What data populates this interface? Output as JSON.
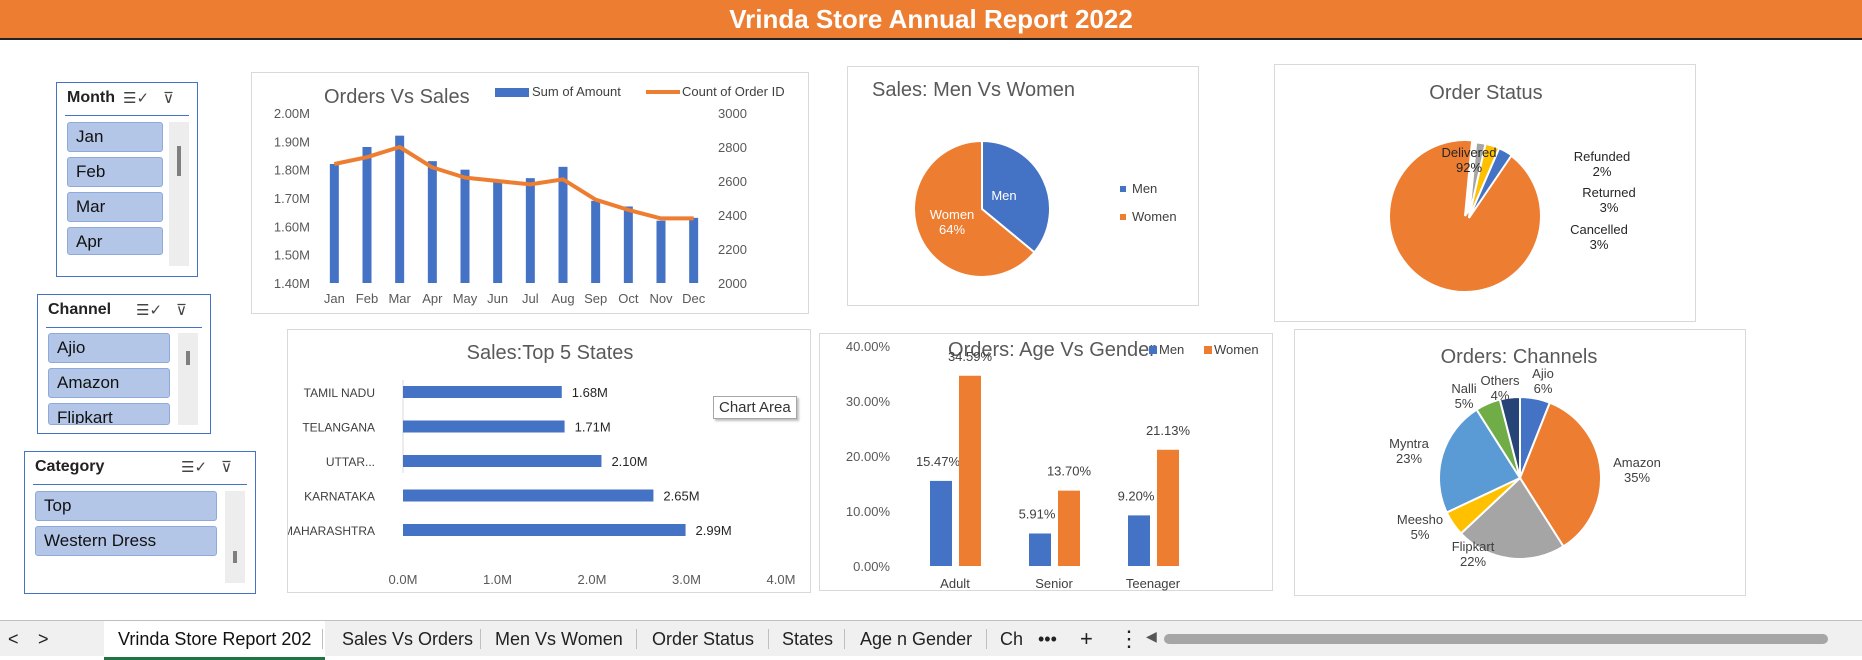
{
  "app": {
    "title": "Vrinda Store Annual Report 2022"
  },
  "slicers": {
    "month": {
      "title": "Month",
      "items": [
        "Jan",
        "Feb",
        "Mar",
        "Apr"
      ]
    },
    "channel": {
      "title": "Channel",
      "items": [
        "Ajio",
        "Amazon",
        "Flipkart"
      ]
    },
    "category": {
      "title": "Category",
      "items": [
        "Top",
        "Western Dress"
      ]
    }
  },
  "tooltip": "Chart Area",
  "tabs": {
    "prev": "<",
    "next": ">",
    "items": [
      "Vrinda Store Report 202",
      "Sales Vs Orders",
      "Men Vs Women",
      "Order Status",
      "States",
      "Age n Gender",
      "Ch"
    ],
    "more": "•••",
    "add": "+",
    "menu": "⋮"
  },
  "colors": {
    "orange": "#ED7D31",
    "blue": "#4472C4",
    "gray": "#A5A5A5",
    "gold": "#FFC000",
    "lightblue": "#5B9BD5",
    "green": "#70AD47",
    "navy": "#264478",
    "slicerItem": "#B4C6E7"
  },
  "chart_data": [
    {
      "id": "orders_vs_sales",
      "type": "bar",
      "title": "Orders Vs Sales",
      "categories": [
        "Jan",
        "Feb",
        "Mar",
        "Apr",
        "May",
        "Jun",
        "Jul",
        "Aug",
        "Sep",
        "Oct",
        "Nov",
        "Dec"
      ],
      "series": [
        {
          "name": "Sum of Amount",
          "type": "bar",
          "axis": "left",
          "values": [
            1.82,
            1.88,
            1.92,
            1.83,
            1.8,
            1.76,
            1.77,
            1.81,
            1.69,
            1.67,
            1.62,
            1.63
          ]
        },
        {
          "name": "Count of Order ID",
          "type": "line",
          "axis": "right",
          "values": [
            2700,
            2740,
            2800,
            2680,
            2620,
            2600,
            2580,
            2610,
            2490,
            2430,
            2380,
            2380
          ]
        }
      ],
      "ylim": [
        1.4,
        2.0
      ],
      "yticks": [
        "1.40M",
        "1.50M",
        "1.60M",
        "1.70M",
        "1.80M",
        "1.90M",
        "2.00M"
      ],
      "y2lim": [
        2000,
        3000
      ],
      "y2ticks": [
        "2000",
        "2200",
        "2400",
        "2600",
        "2800",
        "3000"
      ],
      "legend": "top"
    },
    {
      "id": "men_vs_women",
      "type": "pie",
      "title": "Sales: Men Vs Women",
      "labels": [
        "Men",
        "Women"
      ],
      "values": [
        36,
        64
      ],
      "data_labels": [
        "Men",
        "Women\n64%"
      ],
      "legend": "right"
    },
    {
      "id": "order_status",
      "type": "pie",
      "title": "Order Status",
      "labels": [
        "Delivered",
        "Refunded",
        "Returned",
        "Cancelled"
      ],
      "values": [
        92,
        2,
        3,
        3
      ],
      "data_labels": [
        "Delivered\n92%",
        "Refunded\n2%",
        "Returned\n3%",
        "Cancelled\n3%"
      ]
    },
    {
      "id": "top_states",
      "type": "bar",
      "orientation": "horizontal",
      "title": "Sales:Top 5 States",
      "categories": [
        "TAMIL NADU",
        "TELANGANA",
        "UTTAR...",
        "KARNATAKA",
        "MAHARASHTRA"
      ],
      "values": [
        1.68,
        1.71,
        2.1,
        2.65,
        2.99
      ],
      "data_labels": [
        "1.68M",
        "1.71M",
        "2.10M",
        "2.65M",
        "2.99M"
      ],
      "xlim": [
        0,
        4
      ],
      "xticks": [
        "0.0M",
        "1.0M",
        "2.0M",
        "3.0M",
        "4.0M"
      ]
    },
    {
      "id": "age_vs_gender",
      "type": "bar",
      "title": "Orders: Age Vs Gender",
      "categories": [
        "Adult",
        "Senior",
        "Teenager"
      ],
      "series": [
        {
          "name": "Men",
          "values": [
            15.47,
            5.91,
            9.2
          ],
          "labels": [
            "15.47%",
            "5.91%",
            "9.20%"
          ]
        },
        {
          "name": "Women",
          "values": [
            34.59,
            13.7,
            21.13
          ],
          "labels": [
            "34.59%",
            "13.70%",
            "21.13%"
          ]
        }
      ],
      "ylim": [
        0,
        40
      ],
      "yticks": [
        "0.00%",
        "10.00%",
        "20.00%",
        "30.00%",
        "40.00%"
      ],
      "legend": "top-right"
    },
    {
      "id": "channels",
      "type": "pie",
      "title": "Orders: Channels",
      "labels": [
        "Ajio",
        "Amazon",
        "Flipkart",
        "Meesho",
        "Myntra",
        "Nalli",
        "Others"
      ],
      "values": [
        6,
        35,
        22,
        5,
        23,
        5,
        4
      ],
      "data_labels": [
        "Ajio\n6%",
        "Amazon\n35%",
        "Flipkart\n22%",
        "Meesho\n5%",
        "Myntra\n23%",
        "Nalli\n5%",
        "Others\n4%"
      ]
    }
  ]
}
